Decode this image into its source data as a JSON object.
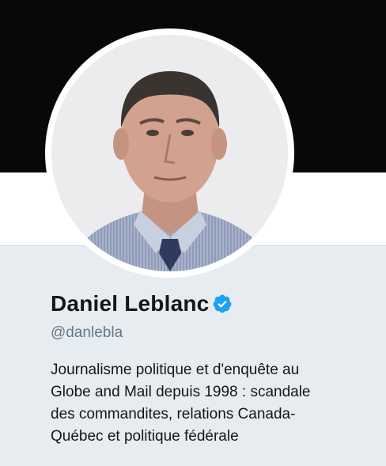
{
  "profile": {
    "display_name": "Daniel Leblanc",
    "handle": "@danlebla",
    "bio_lines": [
      "Journalisme politique et d'enquête au",
      "Globe and Mail depuis 1998 : scandale",
      "des commandites, relations Canada-",
      "Québec et politique fédérale"
    ],
    "verified_icon": "verified-badge-icon",
    "avatar_icon": "profile-photo"
  },
  "colors": {
    "banner": "#080808",
    "panel": "#e6ecf0",
    "verified": "#1da1f2",
    "name": "#14171a",
    "handle": "#657786"
  }
}
